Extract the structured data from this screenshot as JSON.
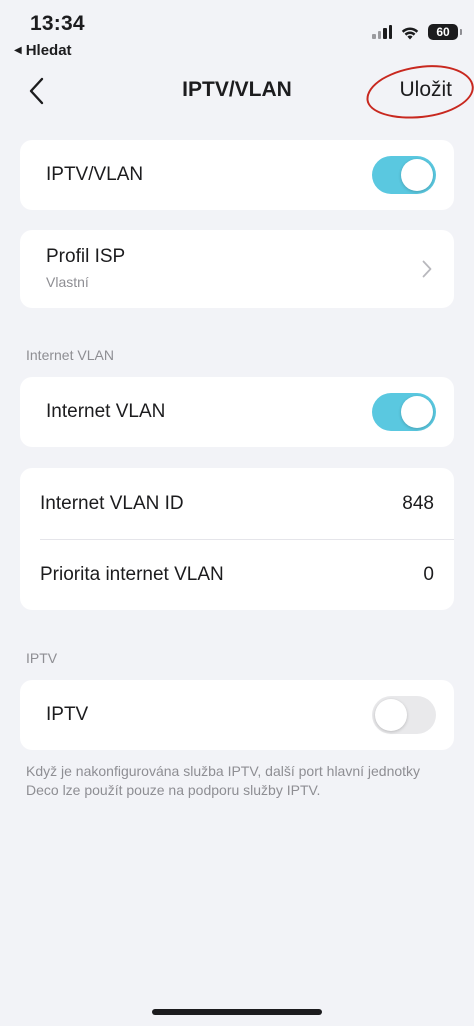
{
  "status_bar": {
    "time": "13:34",
    "back_app": "Hledat",
    "battery": "60"
  },
  "nav": {
    "title": "IPTV/VLAN",
    "save_label": "Uložit",
    "annotation_color": "#c8281f"
  },
  "iptv_vlan": {
    "label": "IPTV/VLAN",
    "enabled": true
  },
  "isp_profile": {
    "label": "Profil ISP",
    "value": "Vlastní"
  },
  "internet_vlan_section": {
    "header": "Internet VLAN",
    "toggle": {
      "label": "Internet VLAN",
      "enabled": true
    },
    "rows": [
      {
        "label": "Internet VLAN ID",
        "value": "848"
      },
      {
        "label": "Priorita internet VLAN",
        "value": "0"
      }
    ]
  },
  "iptv_section": {
    "header": "IPTV",
    "toggle": {
      "label": "IPTV",
      "enabled": false
    },
    "footnote": "Když je nakonfigurována služba IPTV, další port hlavní jednotky Deco lze použít pouze na podporu služby IPTV."
  },
  "colors": {
    "toggle_on": "#5ac8e0",
    "toggle_off": "#e9e9eb",
    "background": "#f2f3f7"
  }
}
